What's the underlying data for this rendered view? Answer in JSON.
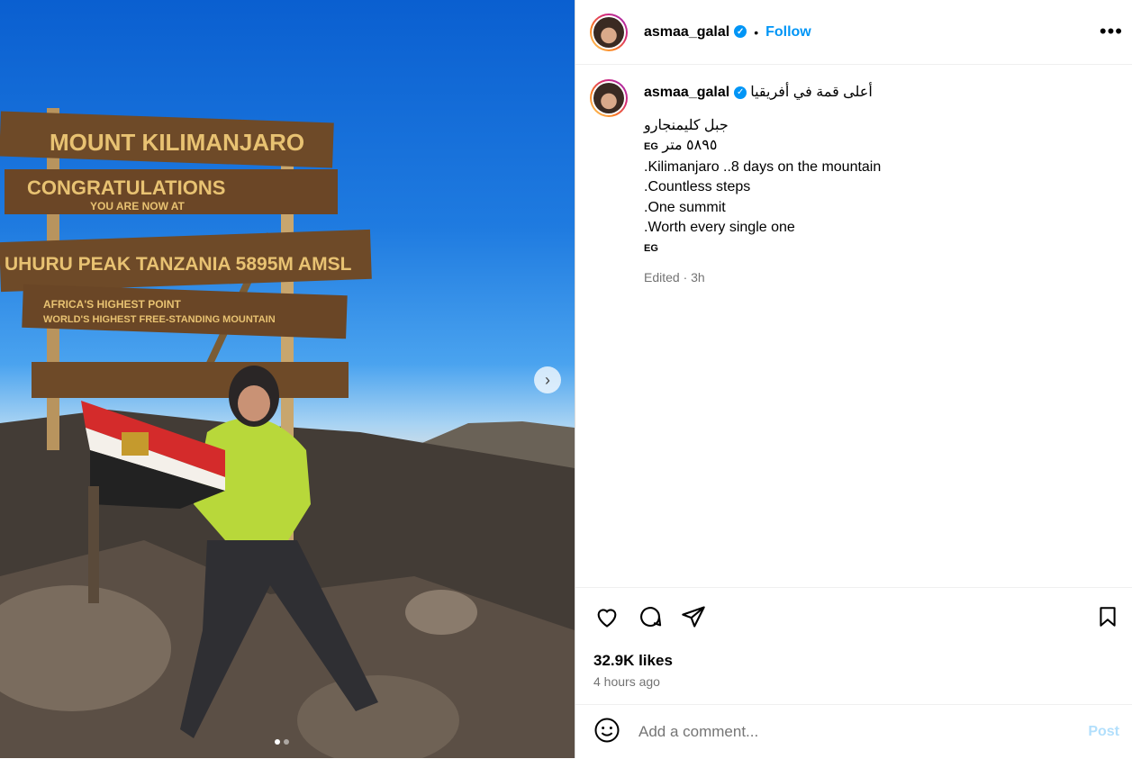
{
  "post": {
    "username": "asmaa_galal",
    "follow_label": "Follow",
    "bullet": "•",
    "more_label": "•••",
    "verified_mark": "✓"
  },
  "photo": {
    "signs": [
      "MOUNT KILIMANJARO",
      "CONGRATULATIONS",
      "YOU ARE NOW AT",
      "UHURU PEAK TANZANIA 5895M AMSL",
      "AFRICA'S HIGHEST POINT",
      "WORLD'S HIGHEST FREE-STANDING MOUNTAIN"
    ],
    "next_label": "›"
  },
  "caption": {
    "username": "asmaa_galal",
    "first_line": "أعلى قمة في أفريقيا",
    "lines": [
      "جبل كليمنجارو",
      "٥٨٩٥ متر",
      ".Kilimanjaro ..8 days on the mountain",
      ".Countless steps",
      ".One summit",
      ".Worth every single one"
    ],
    "flag_tag": "EG",
    "edited": "Edited · 3h"
  },
  "engagement": {
    "likes": "32.9K likes",
    "time_ago": "4 hours ago"
  },
  "comment": {
    "placeholder": "Add a comment...",
    "post_label": "Post"
  },
  "colors": {
    "accent": "#0095f6",
    "post_disabled": "#b2dffc",
    "muted": "#737373"
  },
  "icons": [
    "heart-icon",
    "comment-icon",
    "share-icon",
    "bookmark-icon",
    "emoji-icon",
    "chevron-right-icon",
    "verified-icon"
  ],
  "carousel": {
    "count": 2,
    "active": 1
  }
}
